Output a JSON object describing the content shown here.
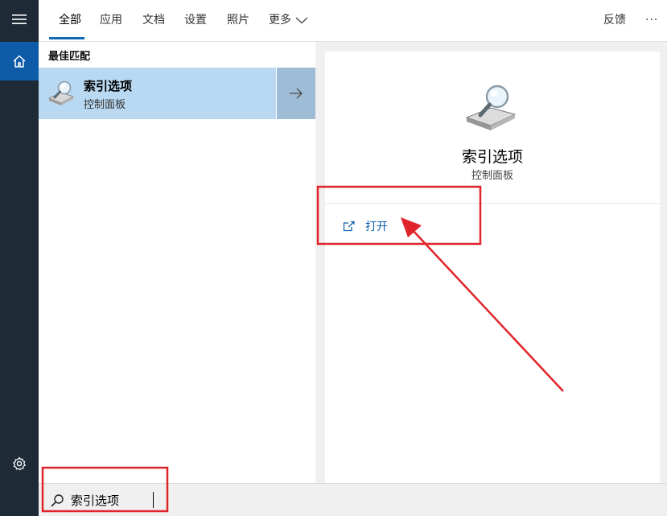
{
  "rail": {
    "menu_icon": "hamburger-icon",
    "home_icon": "home-icon",
    "settings_icon": "gear-icon"
  },
  "tabs": [
    {
      "label": "全部",
      "active": true
    },
    {
      "label": "应用",
      "active": false
    },
    {
      "label": "文档",
      "active": false
    },
    {
      "label": "设置",
      "active": false
    },
    {
      "label": "照片",
      "active": false
    },
    {
      "label": "更多",
      "active": false
    }
  ],
  "topbar": {
    "feedback_label": "反馈",
    "more_options_label": "···"
  },
  "results": {
    "section_heading": "最佳匹配",
    "best_match": {
      "title": "索引选项",
      "subtitle": "控制面板",
      "icon": "indexing-options-icon"
    }
  },
  "preview": {
    "title": "索引选项",
    "subtitle": "控制面板",
    "actions": [
      {
        "label": "打开",
        "icon": "open-external-icon"
      }
    ]
  },
  "search": {
    "query": "索引选项",
    "icon": "search-icon"
  },
  "colors": {
    "rail": "#1e2a36",
    "rail_active": "#0e5ba8",
    "selection": "#b9d8f1",
    "accent": "#0e6ab4",
    "annotation_red": "#e0242b"
  }
}
